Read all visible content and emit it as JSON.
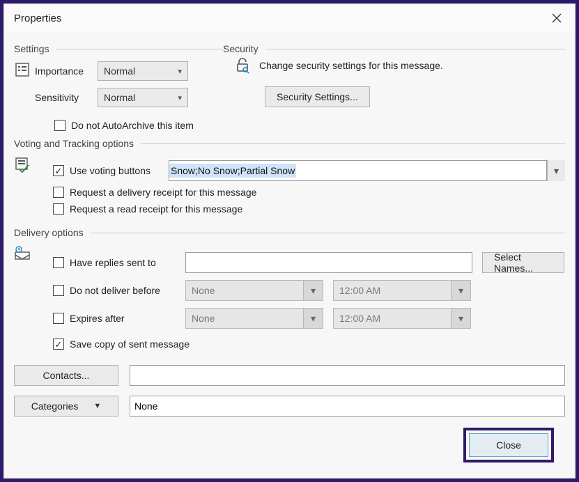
{
  "window": {
    "title": "Properties"
  },
  "settings": {
    "section_label": "Settings",
    "importance_label": "Importance",
    "importance_value": "Normal",
    "sensitivity_label": "Sensitivity",
    "sensitivity_value": "Normal",
    "no_autoarchive_label": "Do not AutoArchive this item",
    "no_autoarchive_checked": false
  },
  "security": {
    "section_label": "Security",
    "description": "Change security settings for this message.",
    "button_label": "Security Settings..."
  },
  "voting": {
    "section_label": "Voting and Tracking options",
    "use_voting_label": "Use voting buttons",
    "use_voting_checked": true,
    "voting_value": "Snow;No Snow;Partial Snow",
    "delivery_receipt_label": "Request a delivery receipt for this message",
    "delivery_receipt_checked": false,
    "read_receipt_label": "Request a read receipt for this message",
    "read_receipt_checked": false
  },
  "delivery": {
    "section_label": "Delivery options",
    "replies_label": "Have replies sent to",
    "replies_checked": false,
    "replies_value": "",
    "select_names_label": "Select Names...",
    "not_before_label": "Do not deliver before",
    "not_before_checked": false,
    "not_before_date": "None",
    "not_before_time": "12:00 AM",
    "expires_label": "Expires after",
    "expires_checked": false,
    "expires_date": "None",
    "expires_time": "12:00 AM",
    "save_copy_label": "Save copy of sent message",
    "save_copy_checked": true,
    "contacts_button": "Contacts...",
    "contacts_value": "",
    "categories_button": "Categories",
    "categories_value": "None"
  },
  "footer": {
    "close_label": "Close"
  }
}
